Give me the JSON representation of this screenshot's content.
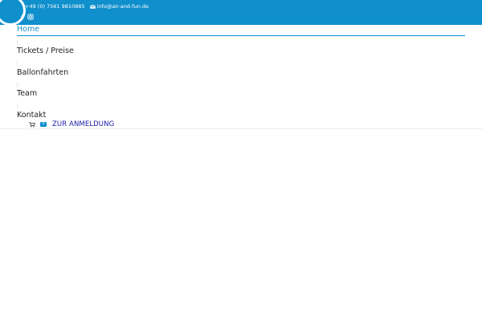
{
  "topbar": {
    "phone": "+49 (0) 7561 9810885",
    "email": "info@air-and-fun.de",
    "icons": [
      "logo-ring",
      "mail-icon",
      "facebook-icon",
      "instagram-icon"
    ],
    "background": "#0f8fcc"
  },
  "nav": {
    "items": [
      {
        "label": "Home",
        "active": true
      },
      {
        "label": "Tickets / Preise",
        "active": false
      },
      {
        "label": "Ballonfahrten",
        "active": false
      },
      {
        "label": "Team",
        "active": false
      },
      {
        "label": "Kontakt",
        "active": false
      }
    ],
    "active_color": "#0f8fcc"
  },
  "cart": {
    "count": "0",
    "cta_label": "ZUR ANMELDUNG",
    "cta_color": "#1a1aa8"
  }
}
